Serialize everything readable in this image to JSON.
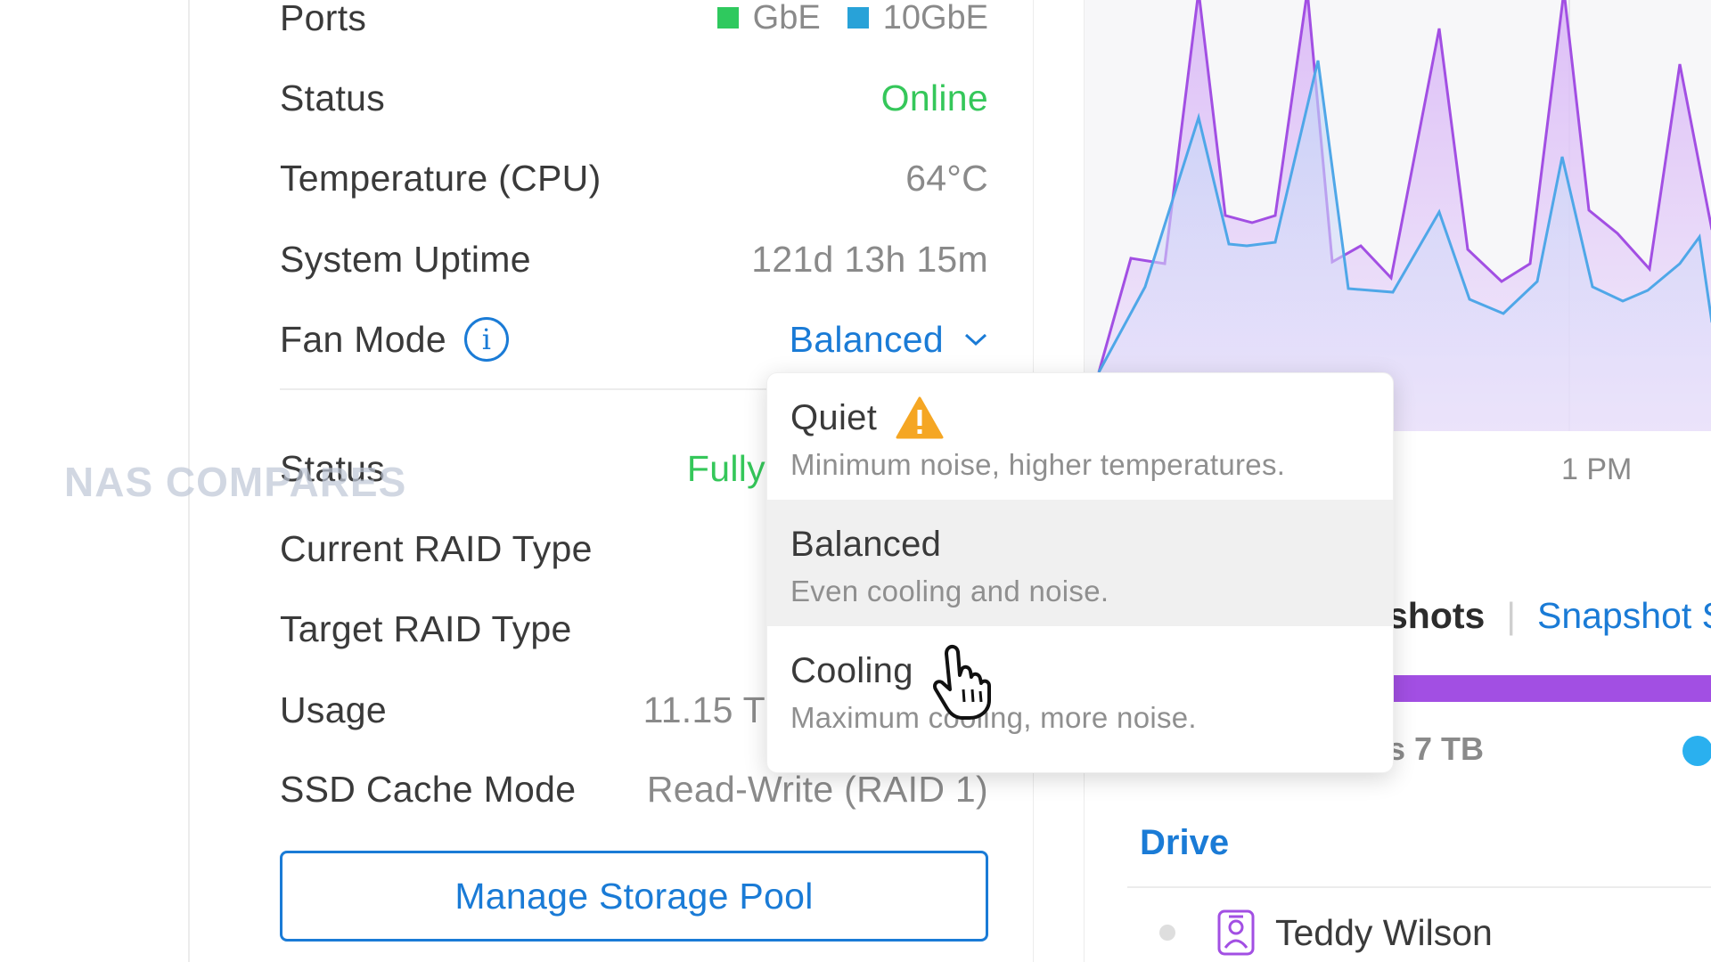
{
  "system_info": {
    "ports": {
      "label": "Ports",
      "legend": [
        {
          "name": "GbE",
          "color": "#2fc95e"
        },
        {
          "name": "10GbE",
          "color": "#28a2d8"
        }
      ]
    },
    "status": {
      "label": "Status",
      "value": "Online"
    },
    "temperature": {
      "label": "Temperature (CPU)",
      "value": "64°C"
    },
    "uptime": {
      "label": "System Uptime",
      "value": "121d 13h 15m"
    },
    "fan_mode": {
      "label": "Fan Mode",
      "value": "Balanced"
    }
  },
  "storage_pool": {
    "status": {
      "label": "Status",
      "value": "Fully"
    },
    "current_raid": {
      "label": "Current RAID Type"
    },
    "target_raid": {
      "label": "Target RAID Type"
    },
    "usage": {
      "label": "Usage",
      "value": "11.15 T"
    },
    "ssd_cache_mode": {
      "label": "SSD Cache Mode",
      "value": "Read-Write (RAID 1)"
    },
    "manage_button": "Manage Storage Pool"
  },
  "watermark": "NAS COMPARES",
  "fan_dropdown": {
    "options": [
      {
        "title": "Quiet",
        "description": "Minimum noise, higher temperatures.",
        "icon": "warning-icon"
      },
      {
        "title": "Balanced",
        "description": "Even cooling and noise.",
        "selected": true
      },
      {
        "title": "Cooling",
        "description": "Maximum cooling, more noise."
      }
    ]
  },
  "chart": {
    "time_label": "1 PM",
    "series_colors": {
      "purple": "#a24fe3",
      "blue": "#4fa7e8"
    }
  },
  "snapshots": {
    "tab_active": "shots",
    "tab_link": "Snapshot S",
    "usage_text": "s 7 TB",
    "bar_color": "#a24fe3"
  },
  "drive": {
    "heading": "Drive",
    "user_name": "Teddy Wilson"
  }
}
